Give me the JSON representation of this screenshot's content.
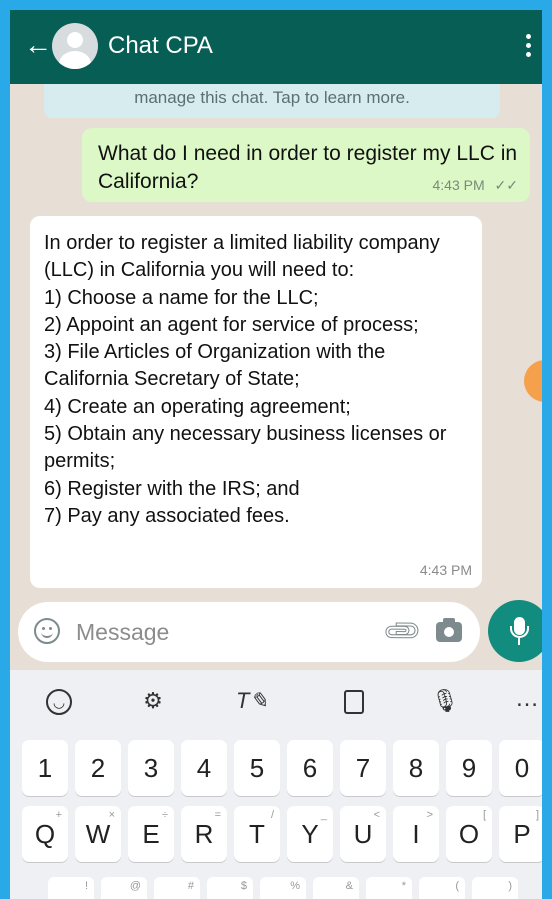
{
  "header": {
    "title": "Chat CPA"
  },
  "chat": {
    "notice": "manage this chat. Tap to learn more.",
    "outgoing": {
      "text": "What do I need in order to register my LLC in California?",
      "time": "4:43 PM",
      "status_icon": "double-check-icon"
    },
    "incoming": {
      "text": "In order to register a limited liability company (LLC) in California you will need to:\n1) Choose a name for the LLC;\n2) Appoint an agent for service of process;\n3) File Articles of Organization with the California Secretary of State;\n4) Create an operating agreement;\n5) Obtain any necessary business licenses or permits;\n6) Register with the IRS; and\n7) Pay any associated fees.",
      "time": "4:43 PM"
    }
  },
  "input": {
    "placeholder": "Message"
  },
  "keyboard": {
    "number_keys": [
      "1",
      "2",
      "3",
      "4",
      "5",
      "6",
      "7",
      "8",
      "9",
      "0"
    ],
    "letter_keys": [
      "Q",
      "W",
      "E",
      "R",
      "T",
      "Y",
      "U",
      "I",
      "O",
      "P"
    ],
    "letter_hints": [
      "+",
      "×",
      "÷",
      "=",
      "/",
      "_",
      "<",
      ">",
      "[",
      "]"
    ],
    "bottom_hints": [
      "!",
      "@",
      "#",
      "$",
      "%",
      "&",
      "*",
      "(",
      ")"
    ],
    "toolbar_more": "…"
  },
  "colors": {
    "header": "#075e54",
    "outgoing_bubble": "#dcf8c6",
    "incoming_bubble": "#ffffff",
    "mic_button": "#128c7e",
    "chat_background": "#e7ded6",
    "frame_border": "#2aa9e8"
  }
}
